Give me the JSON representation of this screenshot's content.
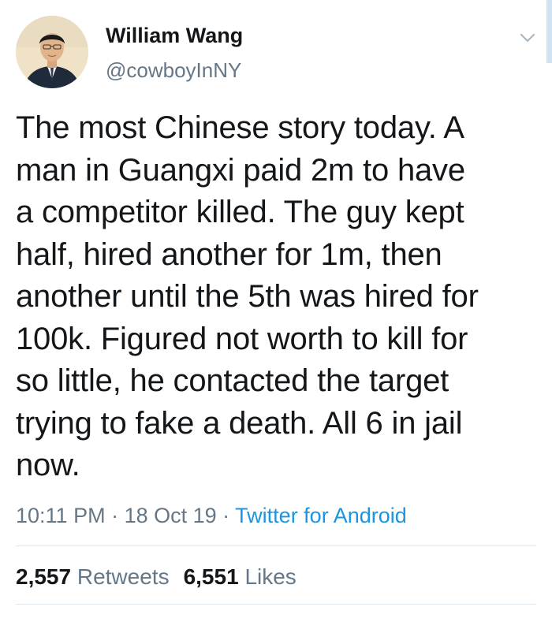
{
  "author": {
    "display_name": "William Wang",
    "handle": "@cowboyInNY"
  },
  "tweet": {
    "text": "The most Chinese story today. A\nman in Guangxi paid 2m to have\na competitor killed. The guy kept\nhalf, hired another for 1m, then\nanother until the 5th was hired for\n100k. Figured not worth to kill for\nso little,  he contacted the target\ntrying to fake a death. All 6 in jail\nnow.",
    "time": "10:11 PM",
    "separator": " · ",
    "date": "18 Oct 19",
    "source": "Twitter for Android"
  },
  "stats": {
    "retweets_count": "2,557",
    "retweets_label": "Retweets",
    "likes_count": "6,551",
    "likes_label": "Likes"
  },
  "icons": {
    "menu": "chevron-down-icon",
    "avatar": "avatar"
  },
  "colors": {
    "text": "#14171a",
    "muted": "#657786",
    "link": "#1b95e0",
    "divider": "#e1e8ed"
  }
}
